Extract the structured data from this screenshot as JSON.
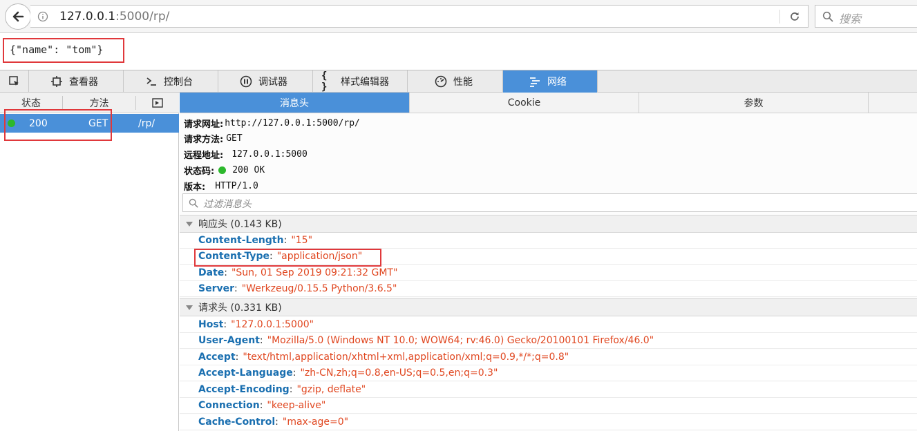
{
  "browser": {
    "url_host": "127.0.0.1",
    "url_rest": ":5000/rp/",
    "search_placeholder": "搜索"
  },
  "page": {
    "body_text": "{\"name\": \"tom\"}"
  },
  "devtools": {
    "tabs": [
      {
        "label": "查看器",
        "icon": "inspector-icon"
      },
      {
        "label": "控制台",
        "icon": "console-icon"
      },
      {
        "label": "调试器",
        "icon": "debugger-icon"
      },
      {
        "label": "样式编辑器",
        "icon": "style-editor-icon"
      },
      {
        "label": "性能",
        "icon": "performance-icon"
      },
      {
        "label": "网络",
        "icon": "network-icon"
      }
    ],
    "active_tab": "网络",
    "accent_color": "#4a90d9"
  },
  "request_list": {
    "columns": {
      "status": "状态",
      "method": "方法"
    },
    "rows": [
      {
        "status": "200",
        "method": "GET",
        "file": "/rp/",
        "status_color": "#2cb82c"
      }
    ]
  },
  "details": {
    "tabs": [
      "消息头",
      "Cookie",
      "参数"
    ],
    "summary": {
      "url_label": "请求网址:",
      "url_value": "http://127.0.0.1:5000/rp/",
      "method_label": "请求方法:",
      "method_value": "GET",
      "remote_label": "远程地址:",
      "remote_value": "127.0.0.1:5000",
      "status_label": "状态码:",
      "status_value": "200 OK",
      "version_label": "版本:",
      "version_value": "HTTP/1.0"
    },
    "filter_placeholder": "过滤消息头",
    "response_headers": {
      "title": "响应头 (0.143 KB)",
      "items": [
        {
          "name": "Content-Length",
          "value": "\"15\""
        },
        {
          "name": "Content-Type",
          "value": "\"application/json\""
        },
        {
          "name": "Date",
          "value": "\"Sun, 01 Sep 2019 09:21:32 GMT\""
        },
        {
          "name": "Server",
          "value": "\"Werkzeug/0.15.5 Python/3.6.5\""
        }
      ]
    },
    "request_headers": {
      "title": "请求头 (0.331 KB)",
      "items": [
        {
          "name": "Host",
          "value": "\"127.0.0.1:5000\""
        },
        {
          "name": "User-Agent",
          "value": "\"Mozilla/5.0 (Windows NT 10.0; WOW64; rv:46.0) Gecko/20100101 Firefox/46.0\""
        },
        {
          "name": "Accept",
          "value": "\"text/html,application/xhtml+xml,application/xml;q=0.9,*/*;q=0.8\""
        },
        {
          "name": "Accept-Language",
          "value": "\"zh-CN,zh;q=0.8,en-US;q=0.5,en;q=0.3\""
        },
        {
          "name": "Accept-Encoding",
          "value": "\"gzip, deflate\""
        },
        {
          "name": "Connection",
          "value": "\"keep-alive\""
        },
        {
          "name": "Cache-Control",
          "value": "\"max-age=0\""
        }
      ]
    }
  }
}
